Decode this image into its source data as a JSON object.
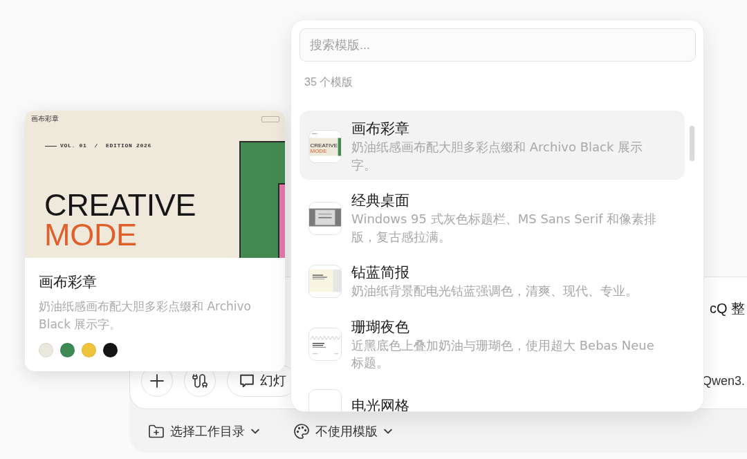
{
  "preview_card": {
    "slide": {
      "brand": "画布彩章",
      "issue": "VOL. 01  /  EDITION 2026",
      "headline": "CREATIVE",
      "accent": "MODE"
    },
    "title": "画布彩章",
    "description": "奶油纸感画布配大胆多彩点缀和 Archivo Black 展示字。",
    "palette": [
      {
        "color": "#ebe8de"
      },
      {
        "color": "#3d8a55"
      },
      {
        "color": "#eec43c"
      },
      {
        "color": "#141414"
      }
    ]
  },
  "template_picker": {
    "search": {
      "placeholder": "搜索模版..."
    },
    "count": "35 个模版",
    "templates": [
      {
        "title": "画布彩章",
        "description": "奶油纸感画布配大胆多彩点缀和 Archivo Black 展示字。",
        "selected": true,
        "thumbnail": {
          "kind": "creative",
          "texts": [
            "CREATIVE",
            "MODE"
          ]
        }
      },
      {
        "title": "经典桌面",
        "description": "Windows 95 式灰色标题栏、MS Sans Serif 和像素排版，复古感拉满。",
        "selected": false,
        "thumbnail": {
          "kind": "desktop"
        }
      },
      {
        "title": "钻蓝简报",
        "description": "奶油纸背景配电光钴蓝强调色，清爽、现代、专业。",
        "selected": false,
        "thumbnail": {
          "kind": "cobalt"
        }
      },
      {
        "title": "珊瑚夜色",
        "description": "近黑底色上叠加奶油与珊瑚色，使用超大 Bebas Neue 标题。",
        "selected": false,
        "thumbnail": {
          "kind": "coral"
        }
      },
      {
        "title": "电光网格",
        "selected": false,
        "thumbnail": {
          "kind": "blank"
        }
      }
    ]
  },
  "composer": {
    "prompt": "cQ 整",
    "tools": [
      {
        "kind": "add"
      },
      {
        "kind": "cable"
      },
      {
        "kind": "slides",
        "label": "幻灯"
      }
    ],
    "model": "Qwen3.",
    "footer": [
      {
        "kind": "folder",
        "label": "选择工作目录"
      },
      {
        "kind": "palette",
        "label": "不使用模版"
      }
    ]
  }
}
